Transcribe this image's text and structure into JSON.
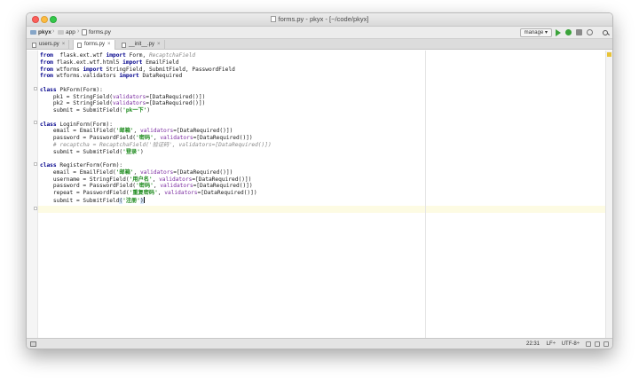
{
  "window": {
    "title": "forms.py - pkyx - [~/code/pkyx]"
  },
  "breadcrumbs": [
    "pkyx",
    "app",
    "forms.py"
  ],
  "toolbar": {
    "run_config": "manage",
    "run_icon": "play-icon",
    "debug_icon": "bug-icon",
    "coverage_icon": "coverage-icon",
    "profile_icon": "profile-icon",
    "search_icon": "search-icon"
  },
  "tabs": [
    {
      "label": "users.py",
      "close": "×"
    },
    {
      "label": "forms.py",
      "close": "×",
      "active": true
    },
    {
      "label": "__init__.py",
      "close": "×"
    }
  ],
  "code_lines": [
    [
      [
        "kw",
        "from"
      ],
      [
        "",
        "  flask.ext.wtf "
      ],
      [
        "kw",
        "import"
      ],
      [
        "",
        " Form, "
      ],
      [
        "cmt",
        "RecaptchaField"
      ]
    ],
    [
      [
        "kw",
        "from"
      ],
      [
        "",
        " flask.ext.wtf.html5 "
      ],
      [
        "kw",
        "import"
      ],
      [
        "",
        " EmailField"
      ]
    ],
    [
      [
        "kw",
        "from"
      ],
      [
        "",
        " wtforms "
      ],
      [
        "kw",
        "import"
      ],
      [
        "",
        " StringField, SubmitField, PasswordField"
      ]
    ],
    [
      [
        "kw",
        "from"
      ],
      [
        "",
        " wtforms.validators "
      ],
      [
        "kw",
        "import"
      ],
      [
        "",
        " DataRequired"
      ]
    ],
    [],
    [
      [
        "kw",
        "class"
      ],
      [
        "",
        " PkForm(Form):"
      ]
    ],
    [
      [
        "",
        "    pk1 = StringField("
      ],
      [
        "param",
        "validators"
      ],
      [
        "",
        "=[DataRequired()])"
      ]
    ],
    [
      [
        "",
        "    pk2 = StringField("
      ],
      [
        "param",
        "validators"
      ],
      [
        "",
        "=[DataRequired()])"
      ]
    ],
    [
      [
        "",
        "    submit = SubmitField("
      ],
      [
        "str",
        "'pk一下'"
      ],
      [
        "",
        ")"
      ]
    ],
    [],
    [
      [
        "kw",
        "class"
      ],
      [
        "",
        " LoginForm(Form):"
      ]
    ],
    [
      [
        "",
        "    email = EmailField("
      ],
      [
        "str",
        "'邮箱'"
      ],
      [
        "",
        ", "
      ],
      [
        "param",
        "validators"
      ],
      [
        "",
        "=[DataRequired()])"
      ]
    ],
    [
      [
        "",
        "    password = PasswordField("
      ],
      [
        "str",
        "'密码'"
      ],
      [
        "",
        ", "
      ],
      [
        "param",
        "validators"
      ],
      [
        "",
        "=[DataRequired()])"
      ]
    ],
    [
      [
        "cmt",
        "    # recaptcha = RecaptchaField('验证码', validators=[DataRequired()])"
      ]
    ],
    [
      [
        "",
        "    submit = SubmitField("
      ],
      [
        "str",
        "'登录'"
      ],
      [
        "",
        ")"
      ]
    ],
    [],
    [
      [
        "kw",
        "class"
      ],
      [
        "",
        " RegisterForm(Form):"
      ]
    ],
    [
      [
        "",
        "    email = EmailField("
      ],
      [
        "str",
        "'邮箱'"
      ],
      [
        "",
        ", "
      ],
      [
        "param",
        "validators"
      ],
      [
        "",
        "=[DataRequired()])"
      ]
    ],
    [
      [
        "",
        "    username = StringField("
      ],
      [
        "str",
        "'用户名'"
      ],
      [
        "",
        ", "
      ],
      [
        "param",
        "validators"
      ],
      [
        "",
        "=[DataRequired()])"
      ]
    ],
    [
      [
        "",
        "    password = PasswordField("
      ],
      [
        "str",
        "'密码'"
      ],
      [
        "",
        ", "
      ],
      [
        "param",
        "validators"
      ],
      [
        "",
        "=[DataRequired()])"
      ]
    ],
    [
      [
        "",
        "    repeat = PasswordField("
      ],
      [
        "str",
        "'重复密码'"
      ],
      [
        "",
        ", "
      ],
      [
        "param",
        "validators"
      ],
      [
        "",
        "=[DataRequired()])"
      ]
    ],
    [
      [
        "",
        "    submit = SubmitField"
      ],
      [
        "hl",
        "("
      ],
      [
        "str",
        "'注册'"
      ],
      [
        "hl",
        ")"
      ]
    ]
  ],
  "status": {
    "position": "22:31",
    "line_sep": "LF÷",
    "encoding": "UTF-8÷"
  }
}
